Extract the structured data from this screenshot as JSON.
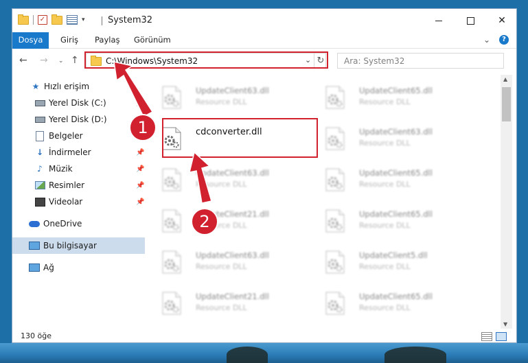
{
  "window": {
    "title": "System32",
    "controls": {
      "minimize": "—",
      "maximize": "□",
      "close": "✕"
    }
  },
  "ribbon": {
    "tabs": [
      "Dosya",
      "Giriş",
      "Paylaş",
      "Görünüm"
    ],
    "collapse": "⌄",
    "help": "?"
  },
  "nav": {
    "back": "←",
    "forward": "→",
    "recent": "⌄",
    "up": "↑",
    "address": "C:\\Windows\\System32",
    "refresh": "↻",
    "search_placeholder": "Ara: System32"
  },
  "sidebar": {
    "items": [
      {
        "label": "Hızlı erişim",
        "icon": "star-icon",
        "pinned": false
      },
      {
        "label": "Yerel Disk (C:)",
        "icon": "drive-icon",
        "pinned": true
      },
      {
        "label": "Yerel Disk (D:)",
        "icon": "drive-icon",
        "pinned": false
      },
      {
        "label": "Belgeler",
        "icon": "document-icon",
        "pinned": true
      },
      {
        "label": "İndirmeler",
        "icon": "download-icon",
        "pinned": true
      },
      {
        "label": "Müzik",
        "icon": "music-icon",
        "pinned": true
      },
      {
        "label": "Resimler",
        "icon": "pictures-icon",
        "pinned": true
      },
      {
        "label": "Videolar",
        "icon": "video-icon",
        "pinned": true
      },
      {
        "label": "OneDrive",
        "icon": "cloud-icon",
        "pinned": false
      },
      {
        "label": "Bu bilgisayar",
        "icon": "computer-icon",
        "pinned": false
      },
      {
        "label": "Ağ",
        "icon": "network-icon",
        "pinned": false
      }
    ],
    "pin_glyph": "📌"
  },
  "files": [
    {
      "name": "UpdateClient63.dll",
      "type": "Resource DLL"
    },
    {
      "name": "UpdateClient65.dll",
      "type": "Resource DLL"
    },
    {
      "name": "cdconverter.dll",
      "type": ""
    },
    {
      "name": "UpdateClient63.dll",
      "type": "Resource DLL"
    },
    {
      "name": "UpdateClient63.dll",
      "type": "Resource DLL"
    },
    {
      "name": "UpdateClient65.dll",
      "type": "Resource DLL"
    },
    {
      "name": "UpdateClient21.dll",
      "type": "Resource DLL"
    },
    {
      "name": "UpdateClient65.dll",
      "type": "Resource DLL"
    },
    {
      "name": "UpdateClient63.dll",
      "type": "Resource DLL"
    },
    {
      "name": "UpdateClient5.dll",
      "type": "Resource DLL"
    },
    {
      "name": "UpdateClient21.dll",
      "type": "Resource DLL"
    },
    {
      "name": "UpdateClient65.dll",
      "type": "Resource DLL"
    }
  ],
  "status": {
    "count": "130 öğe"
  },
  "annotations": {
    "step1": "1",
    "step2": "2",
    "color": "#d1202e"
  }
}
